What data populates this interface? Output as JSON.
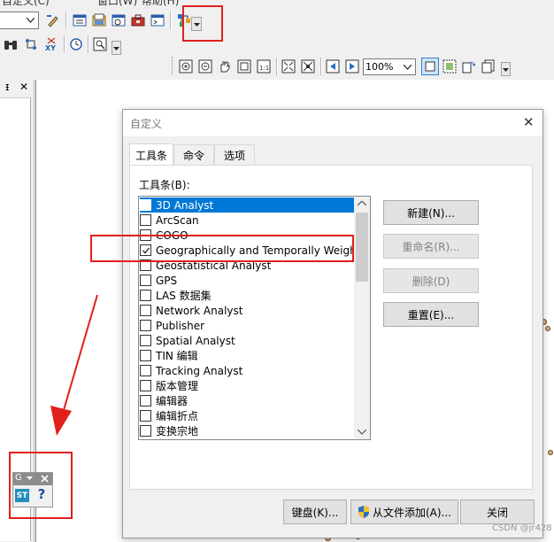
{
  "toolbar": {
    "partial_menu_1": "自定义(C)",
    "partial_menu_2": "窗口(W)",
    "partial_menu_3": "帮助(H)",
    "xy_icon_label": "XY",
    "zoom_value": "100%"
  },
  "left_panel": {
    "pin_label": "ᵻ",
    "close_label": "✕"
  },
  "dialog": {
    "title": "自定义",
    "close_label": "✕",
    "tabs": [
      {
        "label": "工具条"
      },
      {
        "label": "命令"
      },
      {
        "label": "选项"
      }
    ],
    "toolbars_label": "工具条(B):",
    "list_items": [
      {
        "label": "3D Analyst",
        "checked": false,
        "selected": true
      },
      {
        "label": "ArcScan",
        "checked": false,
        "selected": false
      },
      {
        "label": "COGO",
        "checked": false,
        "selected": false
      },
      {
        "label": "Geographically and Temporally Weight",
        "checked": true,
        "selected": false
      },
      {
        "label": "Geostatistical Analyst",
        "checked": false,
        "selected": false
      },
      {
        "label": "GPS",
        "checked": false,
        "selected": false
      },
      {
        "label": "LAS 数据集",
        "checked": false,
        "selected": false
      },
      {
        "label": "Network Analyst",
        "checked": false,
        "selected": false
      },
      {
        "label": "Publisher",
        "checked": false,
        "selected": false
      },
      {
        "label": "Spatial Analyst",
        "checked": false,
        "selected": false
      },
      {
        "label": "TIN 编辑",
        "checked": false,
        "selected": false
      },
      {
        "label": "Tracking Analyst",
        "checked": false,
        "selected": false
      },
      {
        "label": "版本管理",
        "checked": false,
        "selected": false
      },
      {
        "label": "编辑器",
        "checked": false,
        "selected": false
      },
      {
        "label": "编辑折点",
        "checked": false,
        "selected": false
      },
      {
        "label": "变换宗地",
        "checked": false,
        "selected": false
      }
    ],
    "buttons": {
      "new": "新建(N)...",
      "rename": "重命名(R)...",
      "delete": "删除(D)",
      "reset": "重置(E)...",
      "keyboard": "键盘(K)...",
      "add_from_file": "从文件添加(A)...",
      "close": "关闭"
    }
  },
  "floating_toolbar": {
    "title": "G",
    "tool_label": "ST",
    "help_label": "?"
  },
  "watermark": "CSDN @jr428",
  "colors": {
    "annotation_red": "#e0201c",
    "selection_blue": "#0078d7",
    "tool_blue": "#1f8fbf"
  }
}
